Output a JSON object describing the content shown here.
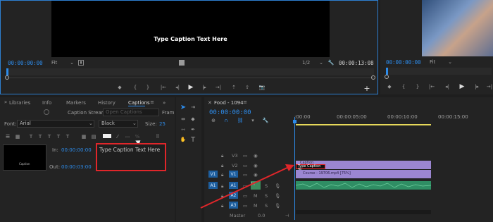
{
  "program": {
    "caption_text": "Type Caption Text Here",
    "timecode": "00:00:00:00",
    "fit": "Fit",
    "resolution": "1/2",
    "duration": "00:00:13:08"
  },
  "source": {
    "timecode": "00:00:00:00",
    "fit": "Fit"
  },
  "captions_panel": {
    "tabs": [
      "Libraries",
      "Info",
      "Markers",
      "History",
      "Captions"
    ],
    "stream_label": "Caption Stream:",
    "stream_value": "Open Captions",
    "font_label": "Font:",
    "font_value": "Arial",
    "color_value": "Black",
    "size_label": "Size:",
    "size_value": "25",
    "in_label": "In:",
    "in_value": "00:00:00:00",
    "out_label": "Out:",
    "out_value": "00:00:03:00",
    "thumb_text": "Caption",
    "caption_entry": "Type Caption Text Here",
    "frame_label": "Fram",
    "font_controls": [
      "T",
      "T",
      "T",
      "T",
      "T"
    ]
  },
  "timeline": {
    "title": "Food - 1094",
    "timecode": "00:00:00:00",
    "ruler": [
      ":00:00",
      "00:00:05:00",
      "00:00:10:00",
      "00:00:15:00"
    ],
    "tracks_video": [
      "V3",
      "V2",
      "V1"
    ],
    "tracks_audio": [
      "A1",
      "A2",
      "A3"
    ],
    "source_patch_v": "V1",
    "source_patch_a": "A1",
    "master_label": "Master",
    "master_value": "0.0",
    "caption_clip": "Type Caption Te",
    "caption_clip_top": "Caption",
    "video_clip": "Course - 19706.mp4 [75%]",
    "mute": "M",
    "solo": "S"
  },
  "accent_color": "#2d8ceb",
  "highlight_color": "#e0262a"
}
